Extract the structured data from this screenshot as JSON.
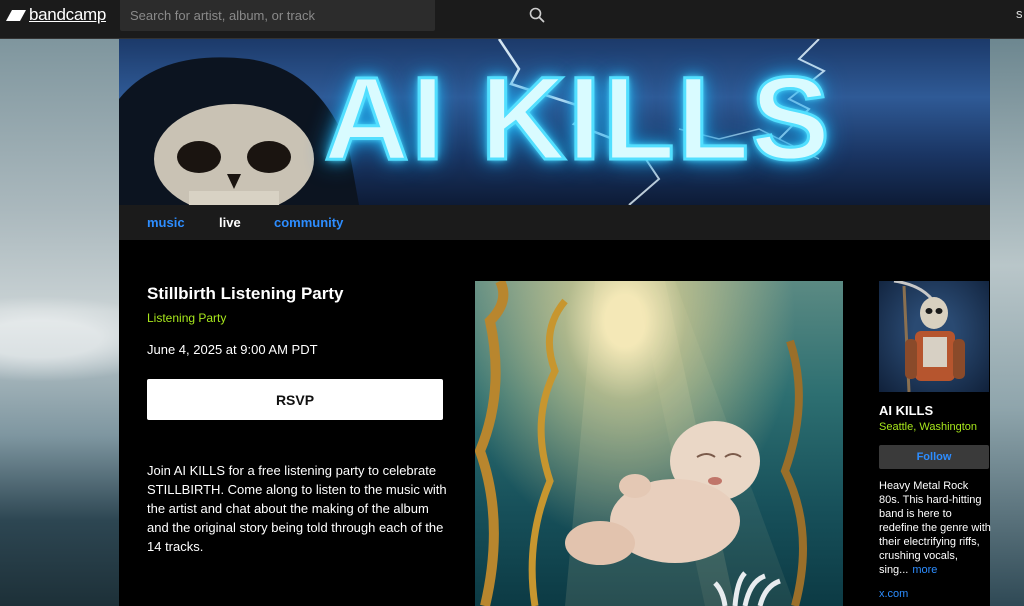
{
  "header": {
    "logo_text": "bandcamp",
    "search_placeholder": "Search for artist, album, or track",
    "right_partial": "s"
  },
  "banner": {
    "title": "AI KILLS"
  },
  "nav": {
    "items": [
      {
        "label": "music",
        "active": false
      },
      {
        "label": "live",
        "active": true
      },
      {
        "label": "community",
        "active": false
      }
    ]
  },
  "event": {
    "title": "Stillbirth Listening Party",
    "type": "Listening Party",
    "date": "June 4, 2025 at 9:00 AM PDT",
    "rsvp_label": "RSVP",
    "description": "Join AI KILLS for a free listening party to celebrate STILLBIRTH. Come along to listen to the music with the artist and chat about the making of the album and the original story being told through each of the 14 tracks."
  },
  "artist": {
    "name": "AI KILLS",
    "location": "Seattle, Washington",
    "follow_label": "Follow",
    "bio": "Heavy Metal Rock 80s. This hard-hitting band is here to redefine the genre with their electrifying riffs, crushing vocals, sing...",
    "more_label": "more",
    "link": "x.com"
  },
  "colors": {
    "accent_link": "#2d8dff",
    "accent_green": "#a8e81c",
    "background": "#000000",
    "topbar": "#1b1b1b"
  }
}
